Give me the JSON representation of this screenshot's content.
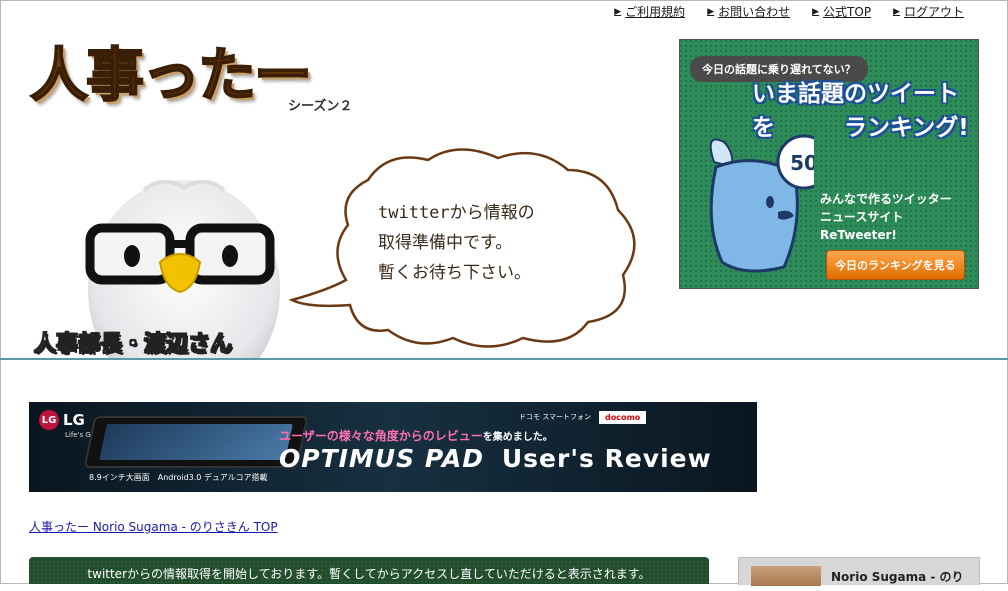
{
  "nav": {
    "items": [
      {
        "label": "ご利用規約"
      },
      {
        "label": "お問い合わせ"
      },
      {
        "label": "公式TOP"
      },
      {
        "label": "ログアウト"
      }
    ]
  },
  "header": {
    "logo": "人事ったー",
    "season": "シーズン２"
  },
  "bubble": {
    "lines": [
      "twitterから情報の",
      "取得準備中です。",
      "暫くお待ち下さい。"
    ]
  },
  "mascot": {
    "label": "人事部長・渡辺さん"
  },
  "ad_retweeter": {
    "pill": "今日の話題に乗り遅れてない？",
    "headline_1": "いま話題のツイートを",
    "headline_2": "ランキング!",
    "desc_1": "みんなで作るツイッター",
    "desc_2": "ニュースサイト",
    "desc_3": "ReTweeter!",
    "button": "今日のランキングを見る",
    "bubble_number": "50",
    "colors": {
      "bg": "#2e8c5a",
      "button": "#f08a1e"
    }
  },
  "banner_lg": {
    "brand": "LG",
    "tagline": "Life's Good",
    "carrier_label": "ドコモ スマートフォン",
    "carrier": "docomo",
    "catch": "ユーザーの様々な角度からのレビュー",
    "catch_tail": "を集めました。",
    "title_brand": "OPTIMUS PAD",
    "title_review": "User's Review",
    "spec": "8.9インチ大画面　Android3.0 デュアルコア搭載"
  },
  "links": {
    "top": "人事ったー Norio Sugama - のりさきん TOP"
  },
  "notice": {
    "text": "twitterからの情報取得を開始しております。暫くしてからアクセスし直していただけると表示されます。"
  },
  "profile": {
    "name": "Norio Sugama - のり"
  }
}
